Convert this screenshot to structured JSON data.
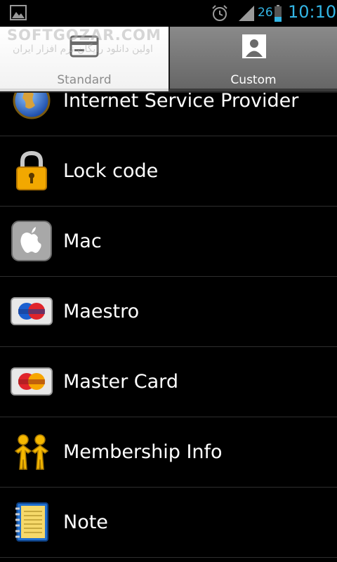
{
  "status_bar": {
    "battery_level": "26",
    "time": "10:10",
    "accent_color": "#33b5e5",
    "icons": [
      "picture-notification-icon",
      "alarm-icon",
      "signal-icon",
      "battery-icon"
    ]
  },
  "watermark": {
    "line1": "SOFTGOZAR.COM",
    "line2": "اولین دانلود رایگان نرم افزار ایران"
  },
  "tabs": [
    {
      "label": "Standard",
      "icon": "card-icon",
      "selected": false
    },
    {
      "label": "Custom",
      "icon": "person-icon",
      "selected": true
    }
  ],
  "list": {
    "items": [
      {
        "label": "Internet Service Provider",
        "icon": "globe-icon"
      },
      {
        "label": "Lock code",
        "icon": "padlock-icon"
      },
      {
        "label": "Mac",
        "icon": "apple-icon"
      },
      {
        "label": "Maestro",
        "icon": "maestro-card-icon"
      },
      {
        "label": "Master Card",
        "icon": "mastercard-icon"
      },
      {
        "label": "Membership Info",
        "icon": "people-icon"
      },
      {
        "label": "Note",
        "icon": "notebook-icon"
      }
    ]
  }
}
